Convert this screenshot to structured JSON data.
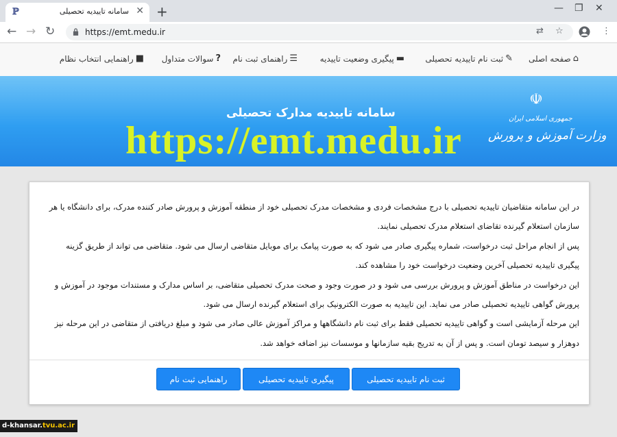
{
  "browser": {
    "tab_title": "سامانه تاییدیه تحصیلی",
    "url": "https://emt.medu.ir",
    "new_tab_symbol": "+",
    "close_symbol": "✕"
  },
  "site_nav": {
    "items": [
      {
        "label": "صفحه اصلی",
        "icon": "home-icon"
      },
      {
        "label": "ثبت نام تاییدیه تحصیلی",
        "icon": "edit-icon"
      },
      {
        "label": "پیگیری وضعیت تاییدیه",
        "icon": "credit-card-icon"
      },
      {
        "label": "راهنمای ثبت نام",
        "icon": "list-icon"
      },
      {
        "label": "سوالات متداول",
        "icon": "question-icon"
      },
      {
        "label": "راهنمایی انتخاب نظام",
        "icon": "square-icon"
      }
    ]
  },
  "banner": {
    "title": "سامانه تاییدیه مدارک تحصیلی",
    "url_text": "https://emt.medu.ir",
    "ministry_small": "جمهوری اسلامی ایران",
    "ministry_big": "وزارت آموزش و پرورش"
  },
  "card": {
    "paragraphs": [
      "در این سامانه متقاضیان تاییدیه تحصیلی با درج مشخصات فردی و مشخصات مدرک تحصیلی خود از منطقه آموزش و پرورش صادر کننده مدرک، برای دانشگاه یا هر سازمان استعلام گیرنده تقاضای استعلام مدرک تحصیلی نمایند.",
      "پس از انجام مراحل ثبت درخواست، شماره پیگیری صادر می شود که به صورت پیامک برای موبایل متقاضی ارسال می شود. متقاضی می تواند از طریق گزینه پیگیری تاییدیه تحصیلی آخرین وضعیت درخواست خود را مشاهده کند.",
      "این درخواست در مناطق آموزش و پرورش بررسی می شود و در صورت وجود و صحت مدرک تحصیلی متقاضی، بر اساس مدارک و مستندات موجود در آموزش و پرورش گواهی تاییدیه تحصیلی صادر می نماید. این تاییدیه به صورت الکترونیک برای استعلام گیرنده ارسال می شود.",
      "این مرحله آزمایشی است و گواهی تاییدیه تحصیلی فقط برای ثبت نام دانشگاهها و مراکز آموزش عالی صادر می شود و مبلغ دریافتی از متقاضی در این مرحله نیز دوهزار و سیصد تومان است. و پس از آن به تدریج بقیه سازمانها و موسسات نیز اضافه خواهد شد."
    ],
    "buttons": {
      "register": "ثبت نام تاییدیه تحصیلی",
      "track": "پیگیری تاییدیه تحصیلی",
      "guide": "راهنمایی ثبت نام"
    }
  },
  "watermark": {
    "prefix": "d-khansar.",
    "suffix": "tvu.ac.ir"
  },
  "colors": {
    "accent": "#1e88f5",
    "banner_url": "#d9f227",
    "banner_top": "#6fc3f7",
    "banner_bottom": "#2387e6"
  }
}
